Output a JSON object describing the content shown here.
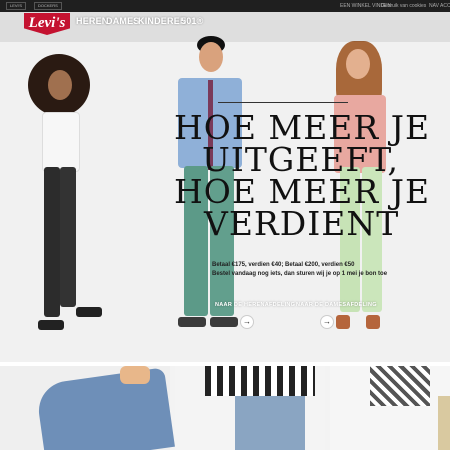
{
  "topbar": {
    "brands": [
      "LEVI'S",
      "DOCKERS"
    ],
    "links": [
      "EEN WINKEL VINDEN",
      "Gebruik van cookies",
      "NAV ACCOUNT"
    ]
  },
  "nav": {
    "logo": "Levi's",
    "items": [
      "HEREN",
      "DAMES",
      "KINDEREN",
      "501®"
    ]
  },
  "hero": {
    "headline": [
      "HOE MEER JE",
      "UITGEEFT,",
      "HOE MEER JE",
      "VERDIENT"
    ],
    "offer": "Betaal €175, verdien €40; Betaal €200, verdien €50",
    "instruction": "Bestel vandaag nog iets, dan sturen wij je op 1 mei je bon toe",
    "cta_men": "NAAR DE HERENAFDELING",
    "cta_women": "NAAR DE DAMESAFDELING",
    "arrow": "→"
  },
  "colors": {
    "brand_red": "#c41230",
    "topbar": "#1f1f1f"
  },
  "icons": {
    "logo": "levis-batwing-logo",
    "arrow": "arrow-right-icon"
  }
}
